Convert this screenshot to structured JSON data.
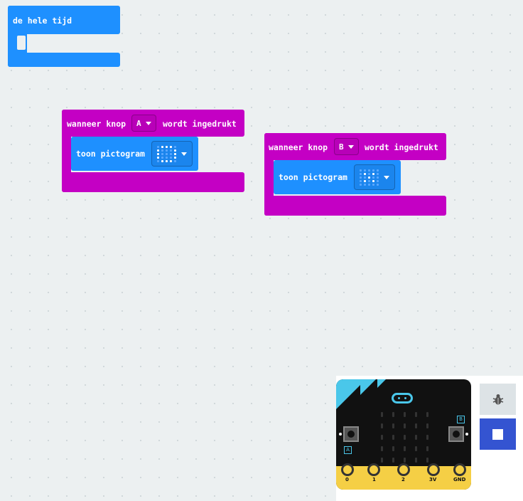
{
  "forever": {
    "label": "de hele tijd"
  },
  "event_a": {
    "prefix": "wanneer knop",
    "button": "A",
    "suffix": "wordt ingedrukt",
    "action": "toon pictogram",
    "leds": [
      0,
      1,
      1,
      1,
      0,
      1,
      0,
      0,
      0,
      1,
      1,
      0,
      0,
      0,
      1,
      1,
      0,
      0,
      0,
      1,
      0,
      1,
      1,
      1,
      0
    ]
  },
  "event_b": {
    "prefix": "wanneer knop",
    "button": "B",
    "suffix": "wordt ingedrukt",
    "action": "toon pictogram",
    "leds": [
      0,
      0,
      0,
      0,
      0,
      0,
      1,
      0,
      1,
      0,
      0,
      0,
      1,
      0,
      0,
      0,
      1,
      0,
      1,
      0,
      0,
      0,
      0,
      0,
      0
    ]
  },
  "simulator": {
    "pins": [
      "0",
      "1",
      "2",
      "3V",
      "GND"
    ],
    "button_a": "A",
    "button_b": "B"
  },
  "colors": {
    "loop": "#1e90ff",
    "input": "#c400c4",
    "accent": "#4ac7ea",
    "stop": "#3454d1"
  }
}
